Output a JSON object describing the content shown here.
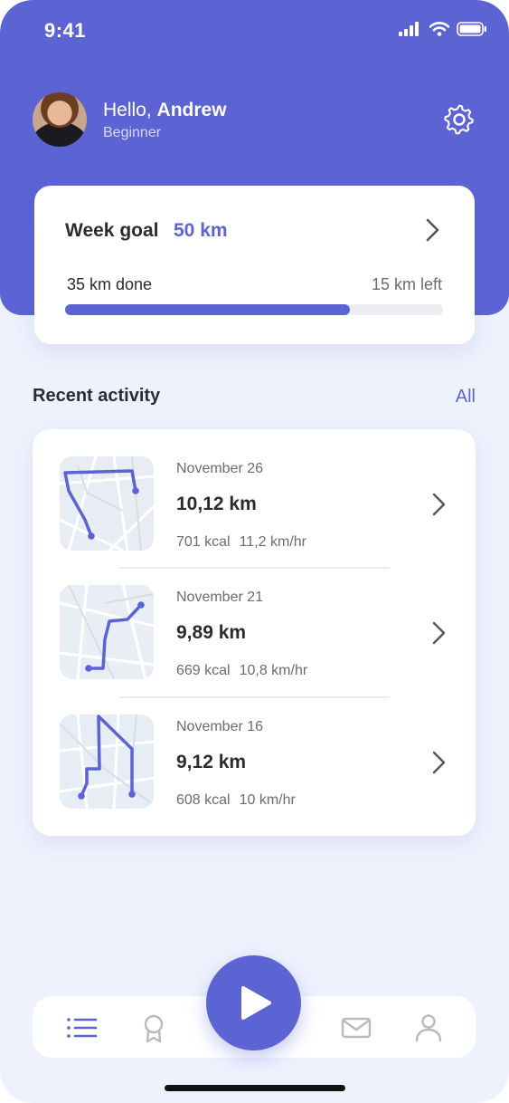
{
  "status_bar": {
    "time": "9:41",
    "icons": [
      "signal-icon",
      "wifi-icon",
      "battery-icon"
    ]
  },
  "user": {
    "greeting": "Hello,",
    "name": "Andrew",
    "level": "Beginner"
  },
  "goal": {
    "title": "Week goal",
    "value": "50 km",
    "done_label": "35 km done",
    "left_label": "15 km left",
    "progress_fraction": 0.753
  },
  "recent": {
    "title": "Recent activity",
    "link": "All",
    "items": [
      {
        "date": "November 26",
        "distance": "10,12 km",
        "kcal": "701 kcal",
        "speed": "11,2 km/hr"
      },
      {
        "date": "November 21",
        "distance": "9,89 km",
        "kcal": "669 kcal",
        "speed": "10,8 km/hr"
      },
      {
        "date": "November 16",
        "distance": "9,12 km",
        "kcal": "608 kcal",
        "speed": "10 km/hr"
      }
    ]
  },
  "nav": [
    "list-icon",
    "award-icon",
    "play-icon",
    "mail-icon",
    "profile-icon"
  ],
  "colors": {
    "accent": "#5c63d3",
    "background": "#eef2fd",
    "card": "#ffffff",
    "text": "#2b2b33",
    "muted": "#6b6b73",
    "inactive_icon": "#b9b9bf"
  }
}
